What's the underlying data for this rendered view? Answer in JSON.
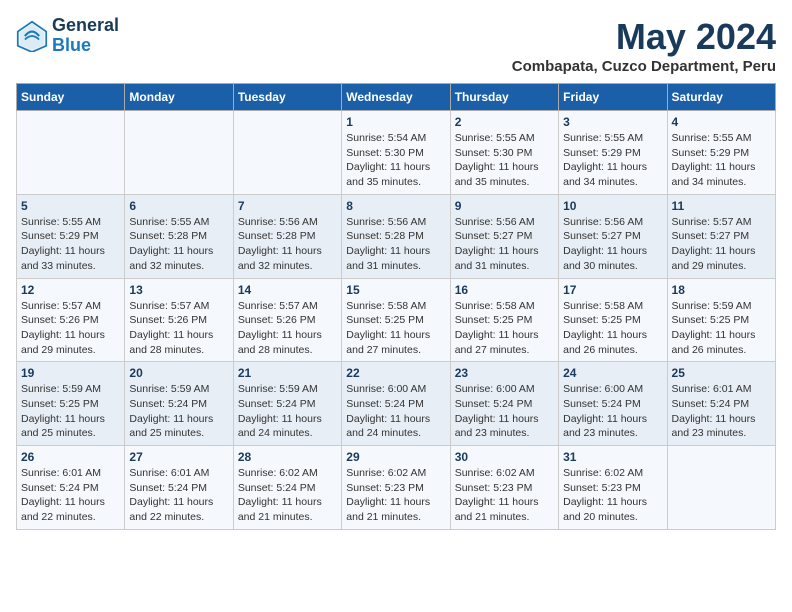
{
  "logo": {
    "general": "General",
    "blue": "Blue"
  },
  "title": "May 2024",
  "subtitle": "Combapata, Cuzco Department, Peru",
  "days_of_week": [
    "Sunday",
    "Monday",
    "Tuesday",
    "Wednesday",
    "Thursday",
    "Friday",
    "Saturday"
  ],
  "weeks": [
    [
      {
        "day": "",
        "info": ""
      },
      {
        "day": "",
        "info": ""
      },
      {
        "day": "",
        "info": ""
      },
      {
        "day": "1",
        "info": "Sunrise: 5:54 AM\nSunset: 5:30 PM\nDaylight: 11 hours\nand 35 minutes."
      },
      {
        "day": "2",
        "info": "Sunrise: 5:55 AM\nSunset: 5:30 PM\nDaylight: 11 hours\nand 35 minutes."
      },
      {
        "day": "3",
        "info": "Sunrise: 5:55 AM\nSunset: 5:29 PM\nDaylight: 11 hours\nand 34 minutes."
      },
      {
        "day": "4",
        "info": "Sunrise: 5:55 AM\nSunset: 5:29 PM\nDaylight: 11 hours\nand 34 minutes."
      }
    ],
    [
      {
        "day": "5",
        "info": "Sunrise: 5:55 AM\nSunset: 5:29 PM\nDaylight: 11 hours\nand 33 minutes."
      },
      {
        "day": "6",
        "info": "Sunrise: 5:55 AM\nSunset: 5:28 PM\nDaylight: 11 hours\nand 32 minutes."
      },
      {
        "day": "7",
        "info": "Sunrise: 5:56 AM\nSunset: 5:28 PM\nDaylight: 11 hours\nand 32 minutes."
      },
      {
        "day": "8",
        "info": "Sunrise: 5:56 AM\nSunset: 5:28 PM\nDaylight: 11 hours\nand 31 minutes."
      },
      {
        "day": "9",
        "info": "Sunrise: 5:56 AM\nSunset: 5:27 PM\nDaylight: 11 hours\nand 31 minutes."
      },
      {
        "day": "10",
        "info": "Sunrise: 5:56 AM\nSunset: 5:27 PM\nDaylight: 11 hours\nand 30 minutes."
      },
      {
        "day": "11",
        "info": "Sunrise: 5:57 AM\nSunset: 5:27 PM\nDaylight: 11 hours\nand 29 minutes."
      }
    ],
    [
      {
        "day": "12",
        "info": "Sunrise: 5:57 AM\nSunset: 5:26 PM\nDaylight: 11 hours\nand 29 minutes."
      },
      {
        "day": "13",
        "info": "Sunrise: 5:57 AM\nSunset: 5:26 PM\nDaylight: 11 hours\nand 28 minutes."
      },
      {
        "day": "14",
        "info": "Sunrise: 5:57 AM\nSunset: 5:26 PM\nDaylight: 11 hours\nand 28 minutes."
      },
      {
        "day": "15",
        "info": "Sunrise: 5:58 AM\nSunset: 5:25 PM\nDaylight: 11 hours\nand 27 minutes."
      },
      {
        "day": "16",
        "info": "Sunrise: 5:58 AM\nSunset: 5:25 PM\nDaylight: 11 hours\nand 27 minutes."
      },
      {
        "day": "17",
        "info": "Sunrise: 5:58 AM\nSunset: 5:25 PM\nDaylight: 11 hours\nand 26 minutes."
      },
      {
        "day": "18",
        "info": "Sunrise: 5:59 AM\nSunset: 5:25 PM\nDaylight: 11 hours\nand 26 minutes."
      }
    ],
    [
      {
        "day": "19",
        "info": "Sunrise: 5:59 AM\nSunset: 5:25 PM\nDaylight: 11 hours\nand 25 minutes."
      },
      {
        "day": "20",
        "info": "Sunrise: 5:59 AM\nSunset: 5:24 PM\nDaylight: 11 hours\nand 25 minutes."
      },
      {
        "day": "21",
        "info": "Sunrise: 5:59 AM\nSunset: 5:24 PM\nDaylight: 11 hours\nand 24 minutes."
      },
      {
        "day": "22",
        "info": "Sunrise: 6:00 AM\nSunset: 5:24 PM\nDaylight: 11 hours\nand 24 minutes."
      },
      {
        "day": "23",
        "info": "Sunrise: 6:00 AM\nSunset: 5:24 PM\nDaylight: 11 hours\nand 23 minutes."
      },
      {
        "day": "24",
        "info": "Sunrise: 6:00 AM\nSunset: 5:24 PM\nDaylight: 11 hours\nand 23 minutes."
      },
      {
        "day": "25",
        "info": "Sunrise: 6:01 AM\nSunset: 5:24 PM\nDaylight: 11 hours\nand 23 minutes."
      }
    ],
    [
      {
        "day": "26",
        "info": "Sunrise: 6:01 AM\nSunset: 5:24 PM\nDaylight: 11 hours\nand 22 minutes."
      },
      {
        "day": "27",
        "info": "Sunrise: 6:01 AM\nSunset: 5:24 PM\nDaylight: 11 hours\nand 22 minutes."
      },
      {
        "day": "28",
        "info": "Sunrise: 6:02 AM\nSunset: 5:24 PM\nDaylight: 11 hours\nand 21 minutes."
      },
      {
        "day": "29",
        "info": "Sunrise: 6:02 AM\nSunset: 5:23 PM\nDaylight: 11 hours\nand 21 minutes."
      },
      {
        "day": "30",
        "info": "Sunrise: 6:02 AM\nSunset: 5:23 PM\nDaylight: 11 hours\nand 21 minutes."
      },
      {
        "day": "31",
        "info": "Sunrise: 6:02 AM\nSunset: 5:23 PM\nDaylight: 11 hours\nand 20 minutes."
      },
      {
        "day": "",
        "info": ""
      }
    ]
  ]
}
